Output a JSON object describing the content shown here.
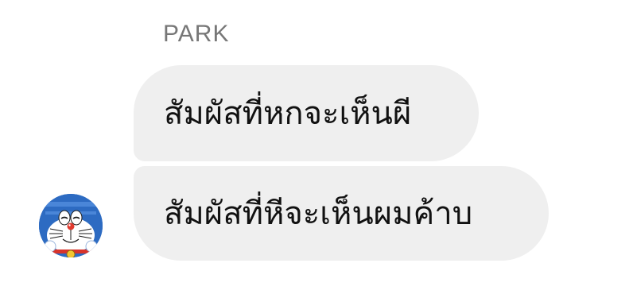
{
  "conversation": {
    "sender_name": "PARK",
    "messages": [
      {
        "text": "สัมผัสที่หกจะเห็นผี"
      },
      {
        "text": "สัมผัสที่หีจะเห็นผมค้าบ"
      }
    ],
    "avatar": {
      "icon": "doraemon-avatar-icon"
    }
  },
  "colors": {
    "bubble_bg": "#efefef",
    "sender_name": "#777777",
    "message_text": "#111111",
    "avatar_blue": "#2d6bc2"
  }
}
